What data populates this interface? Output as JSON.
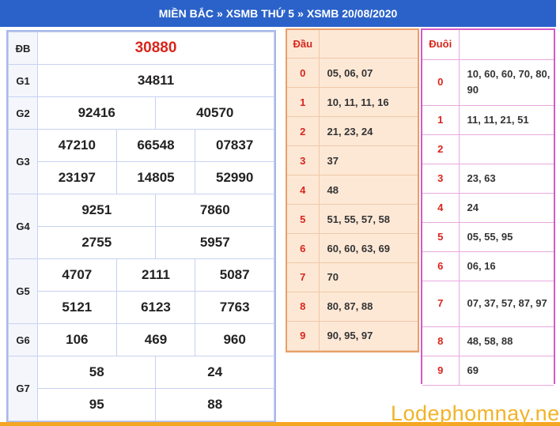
{
  "header": {
    "crumb1": "MIỀN BẮC",
    "crumb2": "XSMB THỨ 5",
    "crumb3": "XSMB 20/08/2020",
    "separator": "»"
  },
  "results": {
    "db": {
      "label": "ĐB",
      "values": [
        "30880"
      ]
    },
    "g1": {
      "label": "G1",
      "values": [
        "34811"
      ]
    },
    "g2": {
      "label": "G2",
      "values": [
        "92416",
        "40570"
      ]
    },
    "g3": {
      "label": "G3",
      "values": [
        "47210",
        "66548",
        "07837",
        "23197",
        "14805",
        "52990"
      ]
    },
    "g4": {
      "label": "G4",
      "values": [
        "9251",
        "7860",
        "2755",
        "5957"
      ]
    },
    "g5": {
      "label": "G5",
      "values": [
        "4707",
        "2111",
        "5087",
        "5121",
        "6123",
        "7763"
      ]
    },
    "g6": {
      "label": "G6",
      "values": [
        "106",
        "469",
        "960"
      ]
    },
    "g7": {
      "label": "G7",
      "values": [
        "58",
        "24",
        "95",
        "88"
      ]
    }
  },
  "dau": {
    "header": "Đầu",
    "rows": [
      {
        "k": "0",
        "v": "05, 06, 07"
      },
      {
        "k": "1",
        "v": "10, 11, 11, 16"
      },
      {
        "k": "2",
        "v": "21, 23, 24"
      },
      {
        "k": "3",
        "v": "37"
      },
      {
        "k": "4",
        "v": "48"
      },
      {
        "k": "5",
        "v": "51, 55, 57, 58"
      },
      {
        "k": "6",
        "v": "60, 60, 63, 69"
      },
      {
        "k": "7",
        "v": "70"
      },
      {
        "k": "8",
        "v": "80, 87, 88"
      },
      {
        "k": "9",
        "v": "90, 95, 97"
      }
    ]
  },
  "duoi": {
    "header": "Đuôi",
    "rows": [
      {
        "k": "0",
        "v": "10, 60, 60, 70, 80, 90"
      },
      {
        "k": "1",
        "v": "11, 11, 21, 51"
      },
      {
        "k": "2",
        "v": ""
      },
      {
        "k": "3",
        "v": "23, 63"
      },
      {
        "k": "4",
        "v": "24"
      },
      {
        "k": "5",
        "v": "05, 55, 95"
      },
      {
        "k": "6",
        "v": "06, 16"
      },
      {
        "k": "7",
        "v": "07, 37, 57, 87, 97"
      },
      {
        "k": "8",
        "v": "48, 58, 88"
      },
      {
        "k": "9",
        "v": "69"
      }
    ]
  },
  "watermark": "Lodephomnay.net",
  "colors": {
    "header_bg": "#2a62c9",
    "special_prize": "#d9251c",
    "dau_bg": "#fde8d6",
    "duoi_border": "#d45ac8",
    "watermark": "#f0b429"
  }
}
